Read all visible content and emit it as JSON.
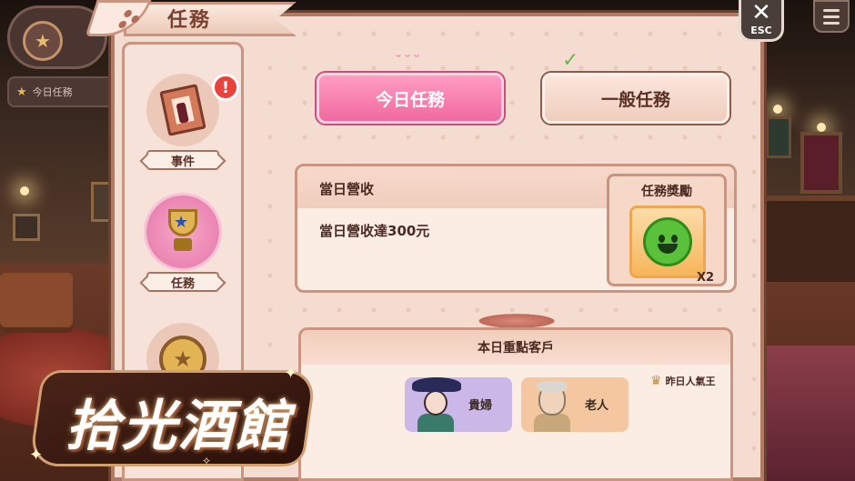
{
  "hud": {
    "task_label": "今日任務"
  },
  "window": {
    "title": "任務",
    "close_label": "ESC"
  },
  "sidebar": {
    "items": [
      {
        "label": "事件",
        "icon": "event-book-icon",
        "alert": "!"
      },
      {
        "label": "任務",
        "icon": "trophy-icon",
        "active": true
      },
      {
        "label": "",
        "icon": "medal-icon"
      }
    ]
  },
  "tabs": [
    {
      "label": "今日任務",
      "active": true
    },
    {
      "label": "一般任務",
      "active": false
    }
  ],
  "task": {
    "title": "當日營收",
    "description": "當日營收達300元",
    "reward_label": "任務獎勵",
    "reward_icon": "smiley-face-icon",
    "reward_count": "X2"
  },
  "customers": {
    "header": "本日重點客戶",
    "list": [
      {
        "name": "貴婦",
        "color": "#cbb8e8"
      },
      {
        "name": "老人",
        "color": "#f5c7a0"
      }
    ],
    "yesterday_label": "昨日人氣王",
    "yesterday_icon": "crown-icon"
  },
  "logo": {
    "text": "拾光酒館"
  },
  "colors": {
    "accent_pink": "#f06aa0",
    "panel_bg": "#f4ddd0",
    "border": "#c99480"
  }
}
